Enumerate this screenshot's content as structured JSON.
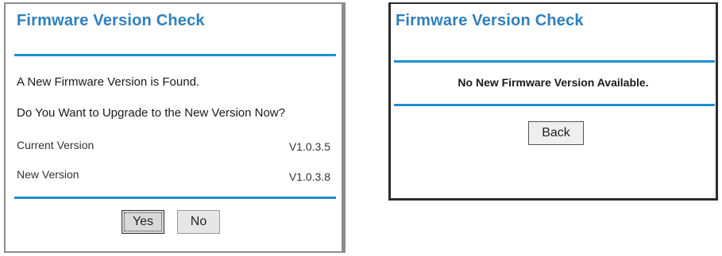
{
  "left_panel": {
    "title": "Firmware Version Check",
    "found_message": "A New Firmware Version is Found.",
    "question": "Do You Want to Upgrade to the New Version Now?",
    "current_version_label": "Current Version",
    "current_version_value": "V1.0.3.5",
    "new_version_label": "New Version",
    "new_version_value": "V1.0.3.8",
    "yes_label": "Yes",
    "no_label": "No"
  },
  "right_panel": {
    "title": "Firmware Version Check",
    "message": "No New Firmware Version Available.",
    "back_label": "Back"
  },
  "colors": {
    "title": "#2f7fbd",
    "rule": "#1c8fd1"
  }
}
